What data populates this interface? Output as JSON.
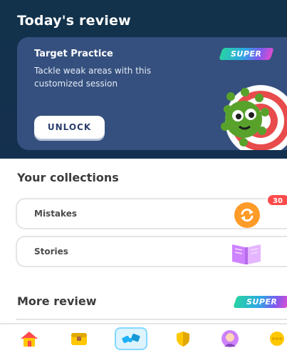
{
  "review": {
    "title": "Today's review",
    "card": {
      "title": "Target Practice",
      "description": "Tackle weak areas with this customized session",
      "badge": "SUPER",
      "unlock_label": "UNLOCK"
    }
  },
  "collections": {
    "title": "Your collections",
    "items": [
      {
        "label": "Mistakes",
        "count": "30",
        "icon": "refresh-icon"
      },
      {
        "label": "Stories",
        "icon": "book-icon"
      }
    ]
  },
  "more_review": {
    "title": "More review",
    "badge": "SUPER"
  },
  "bottom_nav": {
    "items": [
      {
        "icon": "home-icon"
      },
      {
        "icon": "chest-icon"
      },
      {
        "icon": "practice-icon",
        "active": true
      },
      {
        "icon": "shield-icon"
      },
      {
        "icon": "profile-icon"
      },
      {
        "icon": "more-icon"
      }
    ]
  },
  "colors": {
    "header_bg": "#14304f",
    "card_bg": "#35507e",
    "active_nav": "#84d8ff",
    "count_badge": "#ff4b4b",
    "mistakes_icon": "#ff9b28"
  }
}
